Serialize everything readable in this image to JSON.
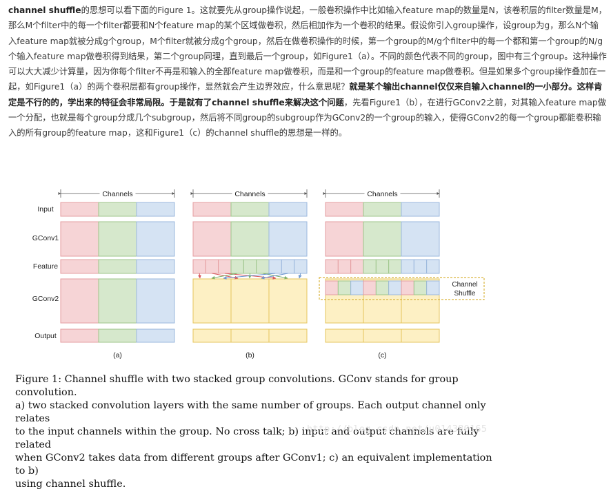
{
  "article": {
    "segments": [
      {
        "text": "channel shuffle",
        "bold": true
      },
      {
        "text": "的思想可以看下面的Figure 1。这就要先从group操作说起，一般卷积操作中比如输入feature map的数量是N，该卷积层的filter数量是M，那么M个filter中的每一个filter都要和N个feature map的某个区域做卷积，然后相加作为一个卷积的结果。假设你引入group操作，设group为g，那么N个输入feature map就被分成g个group，M个filter就被分成g个group，然后在做卷积操作的时候，第一个group的M/g个filter中的每一个都和第一个group的N/g个输入feature map做卷积得到结果，第二个group同理，直到最后一个group，如Figure1（a）。不同的颜色代表不同的group，图中有三个group。这种操作可以大大减少计算量，因为你每个filter不再是和输入的全部feature map做卷积，而是和一个group的feature map做卷积。但是如果多个group操作叠加在一起，如Figure1（a）的两个卷积层都有group操作，显然就会产生边界效应，什么意思呢？",
        "bold": false
      },
      {
        "text": "就是某个输出channel仅仅来自输入channel的一小部分。这样肯定是不行的的，学出来的特征会非常局限。于是就有了channel shuffle来解决这个问题",
        "bold": true
      },
      {
        "text": "，先看Figure1（b），在进行GConv2之前，对其输入feature map做一个分配，也就是每个group分成几个subgroup，然后将不同group的subgroup作为GConv2的一个group的输入，使得GConv2的每一个group都能卷积输入的所有group的feature map，这和Figure1（c）的channel shuffle的思想是一样的。",
        "bold": false
      }
    ]
  },
  "figure": {
    "channels_label": "Channels",
    "row_labels": {
      "input": "Input",
      "gconv1": "GConv1",
      "feature": "Feature",
      "gconv2": "GConv2",
      "output": "Output"
    },
    "panel_labels": [
      "(a)",
      "(b)",
      "(c)"
    ],
    "shuffle_label_line1": "Channel",
    "shuffle_label_line2": "Shuffle",
    "group_colors": {
      "red_fill": "#f6d4d6",
      "red_stroke": "#e49ca0",
      "green_fill": "#d6e8cc",
      "green_stroke": "#9dc58a",
      "blue_fill": "#d5e3f3",
      "blue_stroke": "#9ab7dc",
      "yellow_fill": "#fdf0c4",
      "yellow_stroke": "#e5c45c",
      "dashed_box": "#d9b33c",
      "arrow_red": "#d8595d",
      "arrow_green": "#7fb069",
      "arrow_blue": "#6d97cf"
    }
  },
  "caption": {
    "line1": "Figure 1: Channel shuffle with two stacked group convolutions. GConv stands for group convolution.",
    "line2": "a) two stacked convolution layers with the same number of groups. Each output channel only relates",
    "line3": "to the input channels within the group. No cross talk; b) input and output channels are fully related",
    "line4": "when GConv2 takes data from different groups after GConv1; c) an equivalent implementation to b)",
    "line5": "using channel shuffle."
  },
  "watermark": "http://blog.csdn.net/u014380165"
}
